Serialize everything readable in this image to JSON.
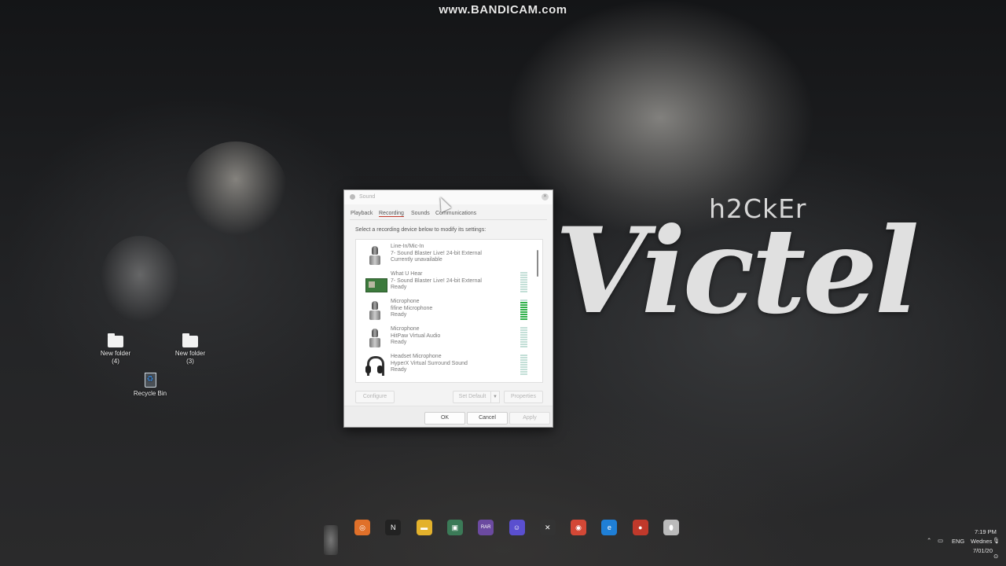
{
  "watermark": "www.BANDICAM.com",
  "wallpaper_text": {
    "small": "h2CkEr",
    "big": "Victel"
  },
  "desktop": {
    "icons": [
      {
        "label": "New folder\n(4)"
      },
      {
        "label": "New folder\n(3)"
      },
      {
        "label": "Recycle Bin"
      }
    ]
  },
  "dialog": {
    "title": "Sound",
    "tabs": [
      "Playback",
      "Recording",
      "Sounds",
      "Communications"
    ],
    "active_tab": "Recording",
    "instruction": "Select a recording device below to modify its settings:",
    "devices": [
      {
        "name": "Line-In/Mic-In",
        "detail": "7- Sound Blaster Live! 24-bit External",
        "status": "Currently unavailable",
        "icon": "microphone-icon",
        "level": null
      },
      {
        "name": "What U Hear",
        "detail": "7- Sound Blaster Live! 24-bit External",
        "status": "Ready",
        "icon": "sound-card-icon",
        "level": 0
      },
      {
        "name": "Microphone",
        "detail": "fifine Microphone",
        "status": "Ready",
        "icon": "microphone-icon",
        "level": 0.9
      },
      {
        "name": "Microphone",
        "detail": "HitPaw Virtual Audio",
        "status": "Ready",
        "icon": "microphone-icon",
        "level": 0
      },
      {
        "name": "Headset Microphone",
        "detail": "HyperX Virtual Surround Sound",
        "status": "Ready",
        "icon": "headset-icon",
        "level": 0
      }
    ],
    "buttons": {
      "configure": "Configure",
      "set_default": "Set Default",
      "properties": "Properties",
      "ok": "OK",
      "cancel": "Cancel",
      "apply": "Apply"
    }
  },
  "taskbar": {
    "apps": [
      {
        "icon": "app-launcher-icon",
        "glyph": "◎"
      },
      {
        "icon": "notion-icon",
        "glyph": "N"
      },
      {
        "icon": "file-explorer-icon",
        "glyph": "▬"
      },
      {
        "icon": "terminal-icon",
        "glyph": "▣"
      },
      {
        "icon": "rar-icon",
        "glyph": "RAR"
      },
      {
        "icon": "discord-icon",
        "glyph": "☺"
      },
      {
        "icon": "capcut-icon",
        "glyph": "✕"
      },
      {
        "icon": "chrome-icon",
        "glyph": "◉"
      },
      {
        "icon": "edge-icon",
        "glyph": "e"
      },
      {
        "icon": "bandicam-record-icon",
        "glyph": "●"
      },
      {
        "icon": "mouse-icon",
        "glyph": "⬮"
      }
    ],
    "tray": {
      "language": "ENG",
      "time": "7:19 PM",
      "day": "Wednes",
      "date": "7/01/20"
    }
  },
  "colors": {
    "accent_tab_underline": "#c0392b",
    "meter_active": "#2fb04a",
    "meter_idle": "#c3dfd7"
  }
}
